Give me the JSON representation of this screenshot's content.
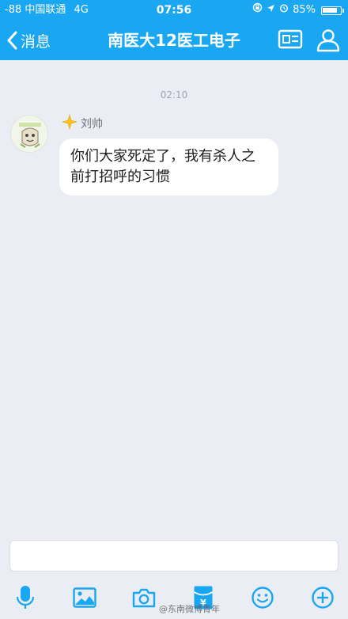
{
  "status_bar": {
    "carrier": "-88 中国联通",
    "network": "4G",
    "time": "07:56",
    "battery": "85%",
    "battery_level": 0.85
  },
  "nav": {
    "back_label": "消息",
    "title": "南医大12医工电子",
    "icons": [
      "profile-card-icon",
      "group-member-icon"
    ]
  },
  "chat": {
    "timestamp": "02:10",
    "messages": [
      {
        "sender": "刘帅",
        "text": "你们大家死定了，我有杀人之前打招呼的习惯"
      }
    ]
  },
  "composer": {
    "tools": [
      "microphone-icon",
      "image-icon",
      "camera-icon",
      "red-packet-icon",
      "emoji-icon",
      "plus-icon"
    ]
  },
  "watermark": "@东南微博青年",
  "colors": {
    "header": "#1aa7f1",
    "background": "#eaedf3",
    "bubble": "#ffffff",
    "icon": "#1aa7f1"
  }
}
